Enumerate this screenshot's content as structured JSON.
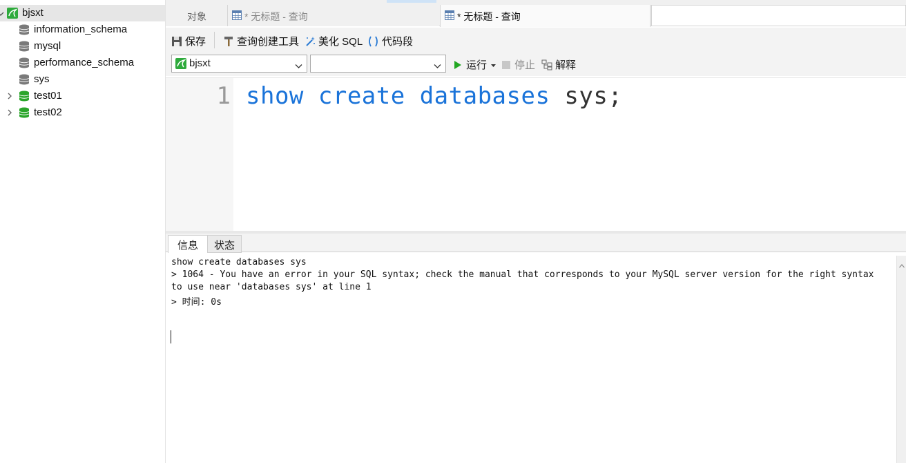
{
  "sidebar": {
    "connection": {
      "label": "bjsxt",
      "icon": "mysql-connection-icon"
    },
    "items": [
      {
        "label": "information_schema",
        "icon": "database-gray-icon",
        "expandable": false
      },
      {
        "label": "mysql",
        "icon": "database-gray-icon",
        "expandable": false
      },
      {
        "label": "performance_schema",
        "icon": "database-gray-icon",
        "expandable": false
      },
      {
        "label": "sys",
        "icon": "database-gray-icon",
        "expandable": false
      },
      {
        "label": "test01",
        "icon": "database-green-icon",
        "expandable": true
      },
      {
        "label": "test02",
        "icon": "database-green-icon",
        "expandable": true
      }
    ]
  },
  "tabs": {
    "objects": "对象",
    "query1": "* 无标题 - 查询",
    "query2": "* 无标题 - 查询"
  },
  "toolbar": {
    "save": "保存",
    "query_builder": "查询创建工具",
    "beautify": "美化 SQL",
    "snippet": "代码段"
  },
  "selectors": {
    "connection_value": "bjsxt",
    "database_value": "",
    "run": "运行",
    "stop": "停止",
    "explain": "解释"
  },
  "editor": {
    "line_number": "1",
    "code_kw1": "show",
    "code_kw2": "create",
    "code_kw3": "databases",
    "code_rest": "sys;"
  },
  "result_tabs": {
    "info": "信息",
    "status": "状态"
  },
  "messages": {
    "line1": "show create databases sys",
    "line2": "> 1064 - You have an error in your SQL syntax; check the manual that corresponds to your MySQL server version for the right syntax",
    "line3": "to use near 'databases sys' at line 1",
    "line4": "> 时间: 0s"
  },
  "colors": {
    "keyword": "#1a73d9",
    "run_green": "#22a722",
    "db_green": "#2aa52a"
  }
}
